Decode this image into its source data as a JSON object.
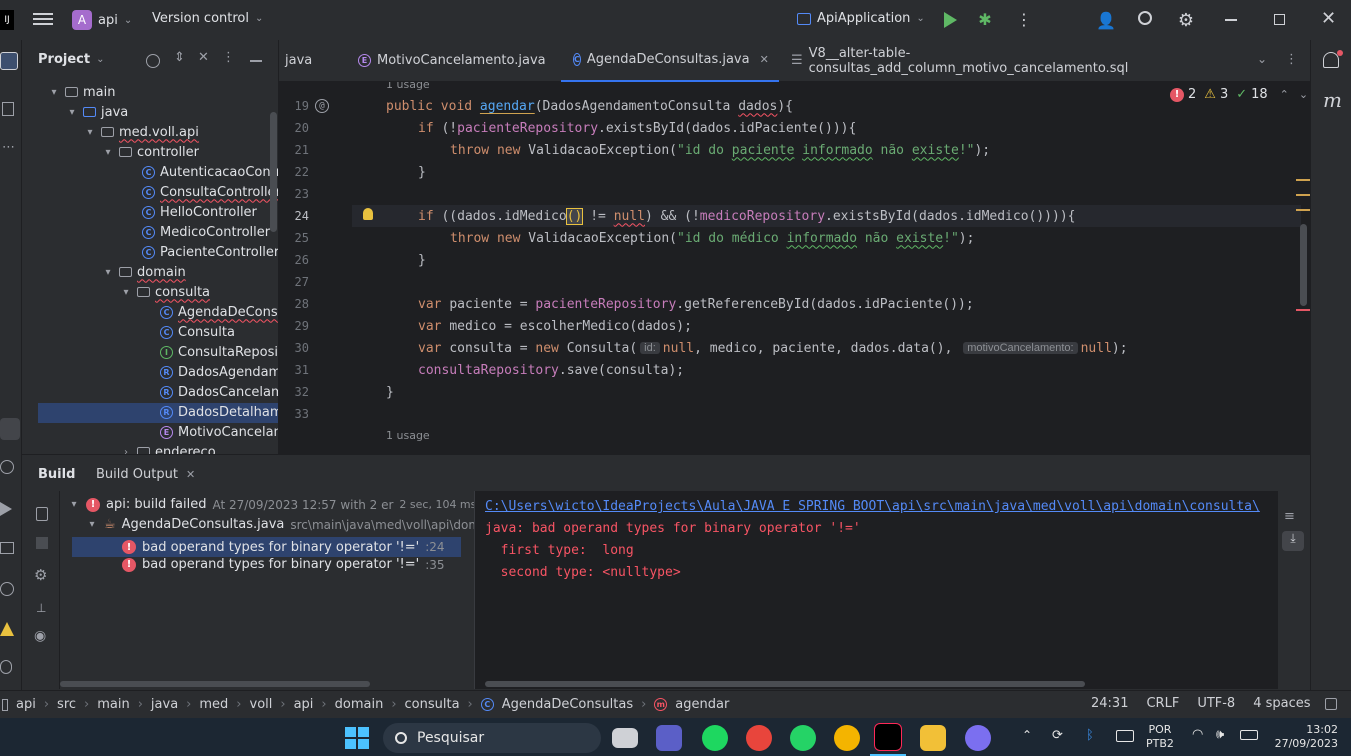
{
  "titlebar": {
    "project_badge": "A",
    "project_name": "api",
    "vcs_label": "Version control",
    "run_config": "ApiApplication"
  },
  "project_panel": {
    "title": "Project",
    "tree": [
      {
        "label": "main",
        "kind": "folder"
      },
      {
        "label": "java",
        "kind": "folder"
      },
      {
        "label": "med.voll.api",
        "kind": "package"
      },
      {
        "label": "controller",
        "kind": "package"
      },
      {
        "label": "AutenticacaoContr",
        "kind": "class"
      },
      {
        "label": "ConsultaController",
        "kind": "class"
      },
      {
        "label": "HelloController",
        "kind": "class"
      },
      {
        "label": "MedicoController",
        "kind": "class"
      },
      {
        "label": "PacienteController",
        "kind": "class"
      },
      {
        "label": "domain",
        "kind": "package"
      },
      {
        "label": "consulta",
        "kind": "package"
      },
      {
        "label": "AgendaDeConsu",
        "kind": "class"
      },
      {
        "label": "Consulta",
        "kind": "class"
      },
      {
        "label": "ConsultaReposit",
        "kind": "interface"
      },
      {
        "label": "DadosAgendam",
        "kind": "record"
      },
      {
        "label": "DadosCancelam",
        "kind": "record"
      },
      {
        "label": "DadosDetalhame",
        "kind": "record"
      },
      {
        "label": "MotivoCancelam",
        "kind": "enum"
      },
      {
        "label": "endereco",
        "kind": "package"
      }
    ]
  },
  "tabs": [
    {
      "label": "java"
    },
    {
      "label": "MotivoCancelamento.java"
    },
    {
      "label": "AgendaDeConsultas.java"
    },
    {
      "label": "V8__alter-table-consultas_add_column_motivo_cancelamento.sql"
    }
  ],
  "editor": {
    "usage_top": "1 usage",
    "usage_bottom": "1 usage",
    "inspections": {
      "errors": "2",
      "warnings": "3",
      "weak": "18"
    },
    "line_numbers": [
      "19",
      "20",
      "21",
      "22",
      "23",
      "24",
      "25",
      "26",
      "27",
      "28",
      "29",
      "30",
      "31",
      "32",
      "33"
    ],
    "code": {
      "l19": [
        "public void ",
        "agendar",
        "(DadosAgendamentoConsulta ",
        "dados",
        "){"
      ],
      "l20": [
        "if ",
        "(!",
        "pacienteRepository",
        ".existsById(dados.idPaciente())){"
      ],
      "l21": [
        "throw new ",
        "ValidacaoException(",
        "\"id do ",
        "paciente",
        " ",
        "informado",
        " não ",
        "existe",
        "!\"",
        ");"
      ],
      "l22": "}",
      "l24": [
        "if ",
        "((dados.idMedico",
        "()",
        " != ",
        "null",
        ") && (!",
        "medicoRepository",
        ".existsById(dados.idMedico()))){"
      ],
      "l25": [
        "throw new ",
        "ValidacaoException(",
        "\"id do médico ",
        "informado",
        " não ",
        "existe",
        "!\"",
        ");"
      ],
      "l26": "}",
      "l28": [
        "var ",
        "paciente = ",
        "pacienteRepository",
        ".getReferenceById(dados.idPaciente());"
      ],
      "l29": [
        "var ",
        "medico = escolherMedico(dados);"
      ],
      "l30": [
        "var ",
        "consulta = ",
        "new ",
        "Consulta(",
        "id:",
        "null",
        ", medico, paciente, dados.data(), ",
        "motivoCancelamento:",
        "null",
        ");"
      ],
      "l31": [
        "consultaRepository",
        ".save(consulta);"
      ],
      "l32": "}"
    }
  },
  "build": {
    "tab_build": "Build",
    "tab_output": "Build Output",
    "root": "api: build failed",
    "root_time": "At 27/09/2023 12:57 with 2 er",
    "root_duration": "2 sec, 104 ms",
    "file": "AgendaDeConsultas.java",
    "file_path": "src\\main\\java\\med\\voll\\api\\dom",
    "errors": [
      {
        "msg": "bad operand types for binary operator '!='",
        "line": ":24"
      },
      {
        "msg": "bad operand types for binary operator '!='",
        "line": ":35"
      }
    ],
    "output_link": "C:\\Users\\wicto\\IdeaProjects\\Aula\\JAVA E SPRING BOOT\\api\\src\\main\\java\\med\\voll\\api\\domain\\consulta\\",
    "output_lines": [
      "java: bad operand types for binary operator '!='",
      "  first type:  long",
      "  second type: <nulltype>"
    ]
  },
  "statusbar": {
    "breadcrumb": [
      "api",
      "src",
      "main",
      "java",
      "med",
      "voll",
      "api",
      "domain",
      "consulta",
      "AgendaDeConsultas",
      "agendar"
    ],
    "position": "24:31",
    "line_sep": "CRLF",
    "encoding": "UTF-8",
    "indent": "4 spaces"
  },
  "taskbar": {
    "search_label": "Pesquisar",
    "lang": "POR",
    "layout": "PTB2",
    "time": "13:02",
    "date": "27/09/2023"
  }
}
